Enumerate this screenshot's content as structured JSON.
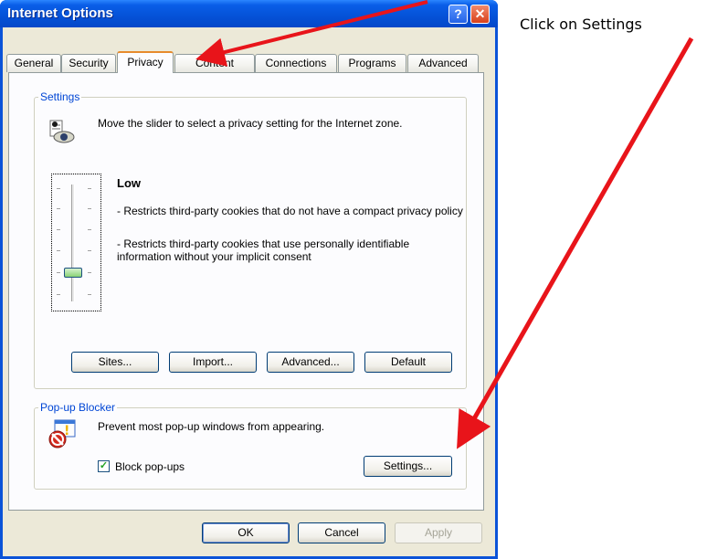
{
  "window": {
    "title": "Internet Options",
    "help_glyph": "?",
    "close_glyph": "✕"
  },
  "tabs": [
    {
      "label": "General"
    },
    {
      "label": "Security"
    },
    {
      "label": "Privacy",
      "active": true
    },
    {
      "label": "Content"
    },
    {
      "label": "Connections"
    },
    {
      "label": "Programs"
    },
    {
      "label": "Advanced"
    }
  ],
  "settings_group": {
    "label": "Settings",
    "icon": "privacy-eye-icon",
    "description": "Move the slider to select a privacy setting for the Internet zone.",
    "level_name": "Low",
    "level_details_1": "- Restricts third-party cookies that do not have a compact privacy policy",
    "level_details_2": "- Restricts third-party cookies that use personally identifiable information without your implicit consent",
    "buttons": {
      "sites": "Sites...",
      "import": "Import...",
      "advanced": "Advanced...",
      "default": "Default"
    }
  },
  "popup_group": {
    "label": "Pop-up Blocker",
    "icon": "popup-blocker-icon",
    "description": "Prevent most pop-up windows from appearing.",
    "block_popups_label": "Block pop-ups",
    "block_popups_checked": true,
    "settings_button": "Settings..."
  },
  "footer": {
    "ok": "OK",
    "cancel": "Cancel",
    "apply": "Apply"
  },
  "annotation": {
    "text": "Click on Settings",
    "arrow_color": "#e8141a"
  },
  "colors": {
    "title_bar": "#0553d9",
    "group_label": "#0046d5",
    "active_tab_accent": "#e68b2c"
  }
}
